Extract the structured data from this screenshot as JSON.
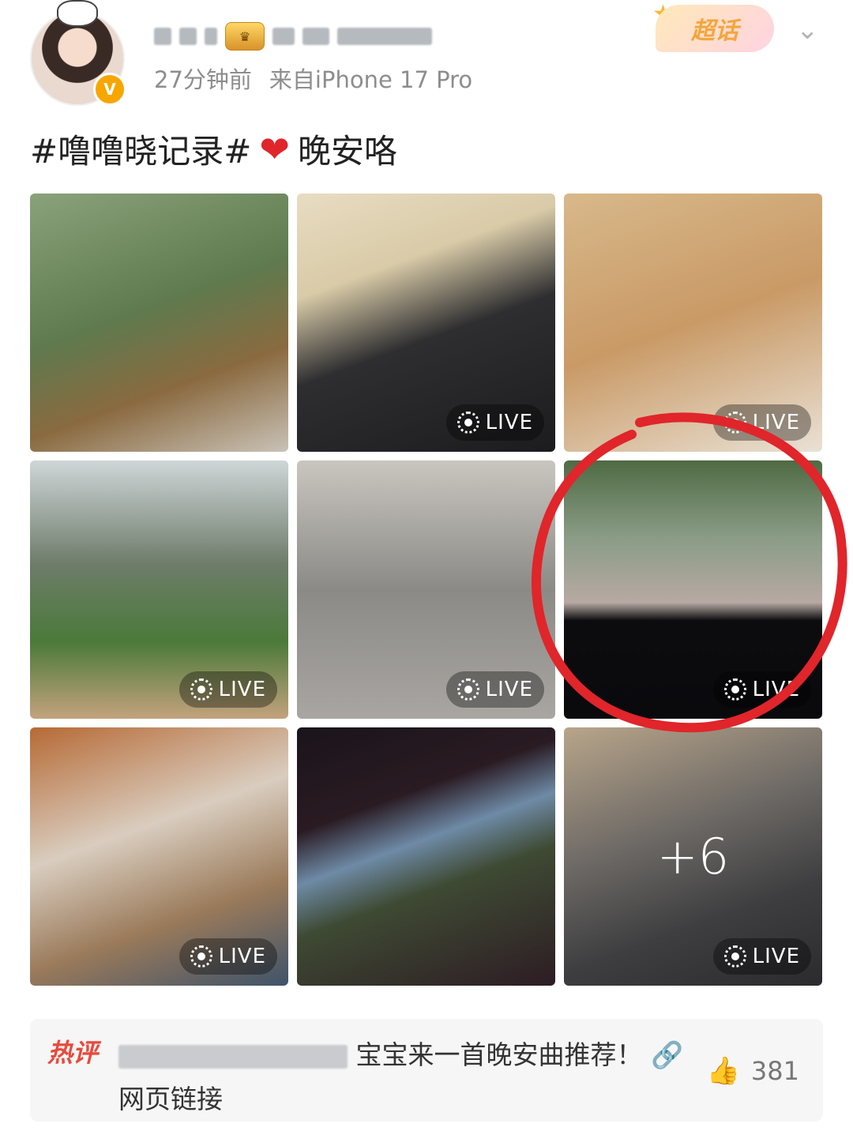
{
  "post": {
    "meta_time": "27分钟前",
    "meta_source": "来自iPhone 17 Pro",
    "chaohua_label": "超话",
    "text_tag": "#噜噜晓记录#",
    "text_emoji": "❤️",
    "text_rest": "晚安咯"
  },
  "grid": {
    "live_label": "LIVE",
    "more_count": "+6"
  },
  "comment": {
    "hot_label": "热评",
    "text": "宝宝来一首晚安曲推荐！",
    "link_label": "网页链接",
    "like_count": "381"
  },
  "colors": {
    "hot_red": "#e84a3b",
    "annotation_red": "#e0252b",
    "meta_gray": "#8d8d8d"
  },
  "icons": {
    "chevron": "chevron-down-icon",
    "like": "thumbs-up-icon",
    "link": "link-icon",
    "live": "live-photo-icon"
  }
}
